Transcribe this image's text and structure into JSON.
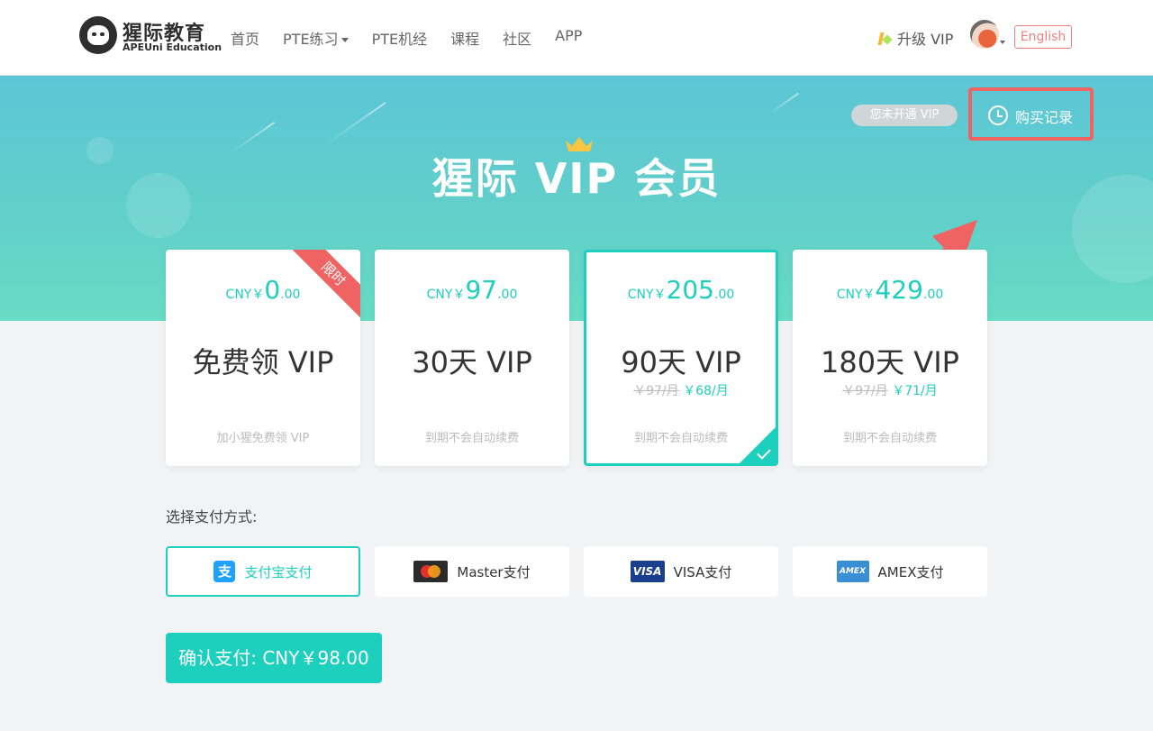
{
  "brand": {
    "name_cn": "猩际教育",
    "name_en": "APEUni Education"
  },
  "nav": {
    "links": [
      "首页",
      "PTE练习",
      "PTE机经",
      "课程",
      "社区",
      "APP"
    ],
    "upgrade_label": "升级 VIP",
    "language_button": "English"
  },
  "hero": {
    "title": "猩际 VIP 会员",
    "status_pill": "您未开通 VIP",
    "history_button": "购买记录"
  },
  "plans": [
    {
      "currency": "CNY￥",
      "price_int": "0",
      "price_dec": ".00",
      "name": "免费领 VIP",
      "orig_monthly": "",
      "disc_monthly": "",
      "note": "加小猩免费领 VIP",
      "ribbon": "限时",
      "selected": false
    },
    {
      "currency": "CNY￥",
      "price_int": "97",
      "price_dec": ".00",
      "name": "30天 VIP",
      "orig_monthly": "",
      "disc_monthly": "",
      "note": "到期不会自动续费",
      "ribbon": "",
      "selected": false
    },
    {
      "currency": "CNY￥",
      "price_int": "205",
      "price_dec": ".00",
      "name": "90天 VIP",
      "orig_monthly": "￥97/月",
      "disc_monthly": "￥68/月",
      "note": "到期不会自动续费",
      "ribbon": "",
      "selected": true
    },
    {
      "currency": "CNY￥",
      "price_int": "429",
      "price_dec": ".00",
      "name": "180天 VIP",
      "orig_monthly": "￥97/月",
      "disc_monthly": "￥71/月",
      "note": "到期不会自动续费",
      "ribbon": "",
      "selected": false
    }
  ],
  "payment": {
    "label": "选择支付方式:",
    "methods": [
      {
        "name": "支付宝支付",
        "icon": "alipay-icon",
        "icon_text": "支",
        "selected": true
      },
      {
        "name": "Master支付",
        "icon": "mastercard-icon",
        "icon_text": "",
        "selected": false
      },
      {
        "name": "VISA支付",
        "icon": "visa-icon",
        "icon_text": "VISA",
        "selected": false
      },
      {
        "name": "AMEX支付",
        "icon": "amex-icon",
        "icon_text": "AMEX",
        "selected": false
      }
    ],
    "confirm_button": "确认支付: CNY￥98.00"
  },
  "colors": {
    "accent": "#1dcfbd",
    "highlight": "#f06363",
    "lang_button": "#f08080"
  }
}
